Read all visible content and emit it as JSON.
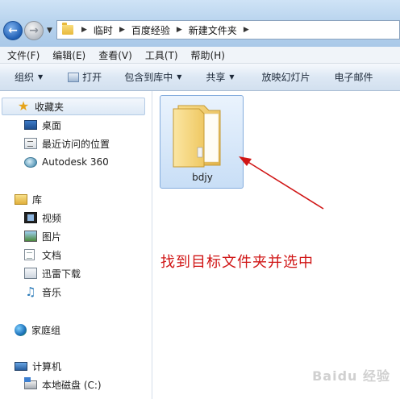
{
  "address": {
    "crumbs": [
      "临时",
      "百度经验",
      "新建文件夹"
    ]
  },
  "menu": {
    "items": [
      "文件(F)",
      "编辑(E)",
      "查看(V)",
      "工具(T)",
      "帮助(H)"
    ]
  },
  "commands": {
    "organize": "组织",
    "open": "打开",
    "include_library": "包含到库中",
    "share": "共享",
    "slideshow": "放映幻灯片",
    "email": "电子邮件"
  },
  "nav": {
    "favorites": "收藏夹",
    "desktop": "桌面",
    "recent": "最近访问的位置",
    "autodesk": "Autodesk 360",
    "library": "库",
    "videos": "视频",
    "pictures": "图片",
    "documents": "文档",
    "thunder": "迅雷下载",
    "music": "音乐",
    "homegroup": "家庭组",
    "computer": "计算机",
    "local_disk": "本地磁盘 (C:)"
  },
  "content": {
    "folder_name": "bdjy",
    "annotation": "找到目标文件夹并选中"
  },
  "watermark": "Baidu 经验",
  "colors": {
    "annotation": "#d01515",
    "selection_border": "#84acdd",
    "chrome": "#b9d4ee"
  }
}
